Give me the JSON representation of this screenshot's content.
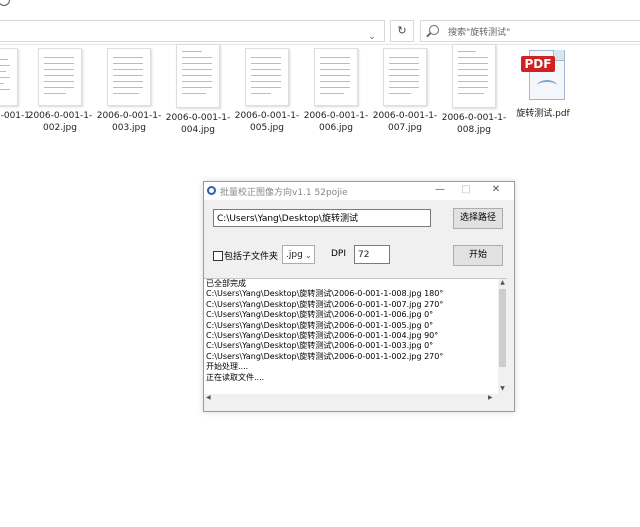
{
  "explorer": {
    "search_placeholder": "搜索\"旋转测试\"",
    "files": [
      {
        "name": "-001-1",
        "type": "jpg"
      },
      {
        "name": "2006-0-001-1-002.jpg",
        "type": "jpg"
      },
      {
        "name": "2006-0-001-1-003.jpg",
        "type": "jpg"
      },
      {
        "name": "2006-0-001-1-004.jpg",
        "type": "jpg"
      },
      {
        "name": "2006-0-001-1-005.jpg",
        "type": "jpg"
      },
      {
        "name": "2006-0-001-1-006.jpg",
        "type": "jpg"
      },
      {
        "name": "2006-0-001-1-007.jpg",
        "type": "jpg"
      },
      {
        "name": "2006-0-001-1-008.jpg",
        "type": "jpg"
      },
      {
        "name": "旋转测试.pdf",
        "type": "pdf"
      }
    ],
    "pdf_badge": "PDF"
  },
  "dialog": {
    "title": "批量校正图像方向v1.1   52pojie",
    "path_value": "C:\\Users\\Yang\\Desktop\\旋转测试",
    "browse_label": "选择路径",
    "include_subfolders_label": "包括子文件夹",
    "include_subfolders_checked": false,
    "extension_value": ".jpg",
    "dpi_label": "DPI",
    "dpi_value": "72",
    "start_label": "开始",
    "log_lines": [
      "已全部完成",
      "C:\\Users\\Yang\\Desktop\\旋转测试\\2006-0-001-1-008.jpg  180°",
      "C:\\Users\\Yang\\Desktop\\旋转测试\\2006-0-001-1-007.jpg  270°",
      "C:\\Users\\Yang\\Desktop\\旋转测试\\2006-0-001-1-006.jpg  0°",
      "C:\\Users\\Yang\\Desktop\\旋转测试\\2006-0-001-1-005.jpg  0°",
      "C:\\Users\\Yang\\Desktop\\旋转测试\\2006-0-001-1-004.jpg  90°",
      "C:\\Users\\Yang\\Desktop\\旋转测试\\2006-0-001-1-003.jpg  0°",
      "C:\\Users\\Yang\\Desktop\\旋转测试\\2006-0-001-1-002.jpg  270°",
      "开始处理....",
      "正在读取文件...."
    ]
  }
}
